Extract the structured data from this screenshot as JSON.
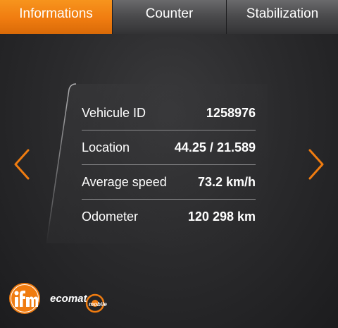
{
  "tabs": [
    {
      "label": "Informations",
      "active": true
    },
    {
      "label": "Counter",
      "active": false
    },
    {
      "label": "Stabilization",
      "active": false
    }
  ],
  "info": {
    "rows": [
      {
        "label": "Vehicule ID",
        "value": "1258976"
      },
      {
        "label": "Location",
        "value": "44.25 / 21.589"
      },
      {
        "label": "Average speed",
        "value": "73.2 km/h"
      },
      {
        "label": "Odometer",
        "value": "120 298 km"
      }
    ]
  },
  "navigation": {
    "previous_icon": "chevron-left-icon",
    "next_icon": "chevron-right-icon"
  },
  "branding": {
    "ifm_logo_text": "ifm",
    "ecomat_logo_text": "ecomat",
    "ecomat_logo_subtext": "mobile"
  },
  "colors": {
    "accent": "#f07c10",
    "background": "#2b2b2d",
    "tab_inactive": "#4c4c4e",
    "divider": "#8a8a8c"
  }
}
